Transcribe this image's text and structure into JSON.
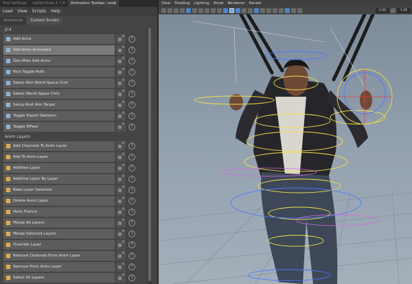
{
  "window_tabs": [
    "Tool Settings",
    "ngSkinTools 1.7.6",
    "Animation Toolbar: coob"
  ],
  "menubar": [
    "Load",
    "View",
    "Scripts",
    "Help"
  ],
  "panel_tabs": [
    "Avalanche",
    "Custom Scripts"
  ],
  "sections": [
    {
      "title": "JC4",
      "items": [
        {
          "label": "Add Arms",
          "icon": "document-icon"
        },
        {
          "label": "Add Arms Animated",
          "icon": "document-icon"
        },
        {
          "label": "Gen Male Add Arms",
          "icon": "document-icon"
        },
        {
          "label": "Rico Toggle Rolls",
          "icon": "document-icon"
        },
        {
          "label": "Select Non World Space Ctrls",
          "icon": "document-icon"
        },
        {
          "label": "Select World Space Ctrls",
          "icon": "document-icon"
        },
        {
          "label": "Setup Root Aim Target",
          "icon": "document-icon"
        },
        {
          "label": "Toggle Export Skeleton",
          "icon": "document-icon"
        },
        {
          "label": "Toggle IKFeet",
          "icon": "document-icon"
        }
      ]
    },
    {
      "title": "Anim Layers",
      "items": [
        {
          "label": "Add Channels To Anim Layer",
          "icon": "layer-icon"
        },
        {
          "label": "Add To Anim Layer",
          "icon": "layer-icon"
        },
        {
          "label": "Additive Layer",
          "icon": "layer-icon"
        },
        {
          "label": "Additive Layer By Layer",
          "icon": "layer-icon"
        },
        {
          "label": "Bake Layer Selected",
          "icon": "layer-icon"
        },
        {
          "label": "Delete Anim Layer",
          "icon": "layer-icon"
        },
        {
          "label": "Hello Francis",
          "icon": "layer-icon"
        },
        {
          "label": "Merge All Layers",
          "icon": "layer-icon"
        },
        {
          "label": "Merge Selected Layers",
          "icon": "layer-icon"
        },
        {
          "label": "Override Layer",
          "icon": "layer-icon"
        },
        {
          "label": "Remove Channels From Anim Layer",
          "icon": "layer-icon"
        },
        {
          "label": "Remove From Anim Layer",
          "icon": "layer-icon"
        },
        {
          "label": "Select All Layers",
          "icon": "layer-icon"
        }
      ]
    }
  ],
  "row_counter": "0",
  "help_glyph": "?",
  "viewport": {
    "menu": [
      "View",
      "Shading",
      "Lighting",
      "Show",
      "Renderer",
      "Panels"
    ],
    "field_left": "0.00",
    "field_right": "1.00"
  },
  "colors": {
    "button": "#5d5d5d",
    "button_hover": "#7a7a7a",
    "doc_icon": "#7fb0d8",
    "layer_icon": "#e0a33a",
    "control_yellow": "#f5e04a",
    "viewport_bg": "#8e9bab"
  }
}
